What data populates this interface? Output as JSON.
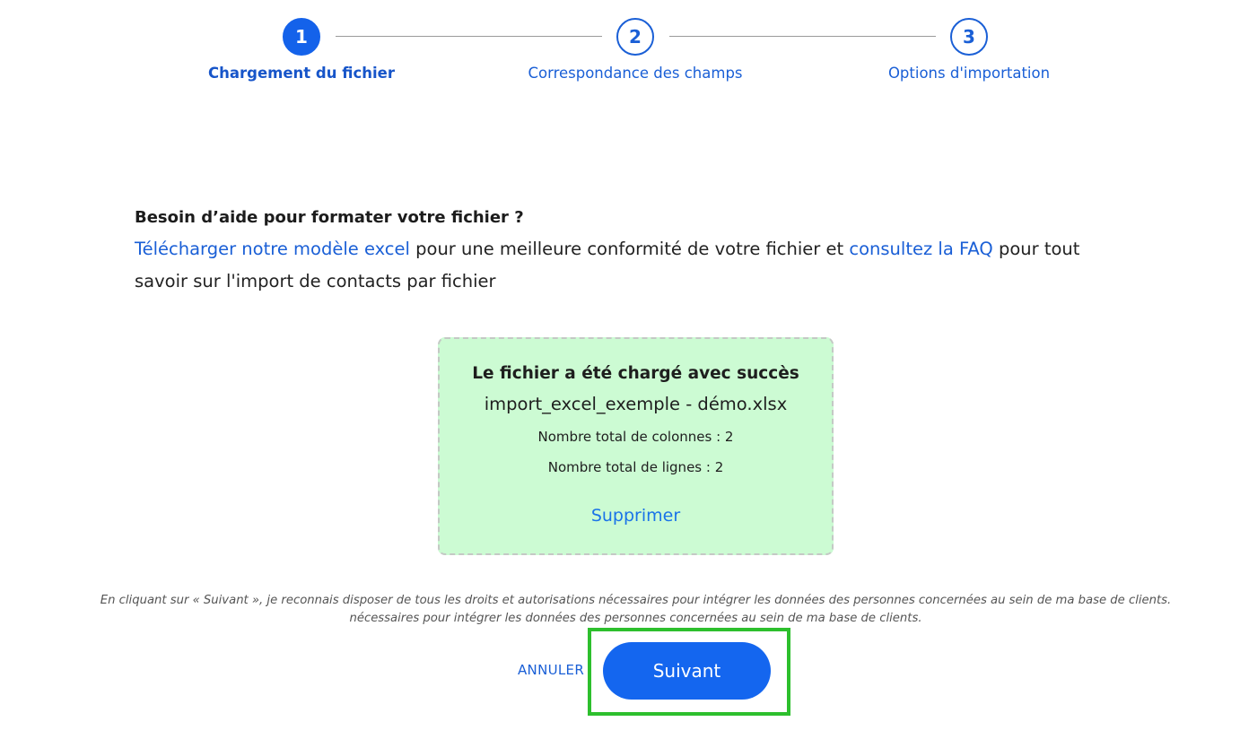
{
  "stepper": {
    "steps": [
      {
        "number": "1",
        "label": "Chargement du fichier",
        "state": "active"
      },
      {
        "number": "2",
        "label": "Correspondance des champs",
        "state": "pending"
      },
      {
        "number": "3",
        "label": "Options d'importation",
        "state": "pending"
      }
    ]
  },
  "help": {
    "title": "Besoin d’aide pour formater votre fichier ?",
    "link_template": "Télécharger notre modèle excel",
    "text_middle": " pour une meilleure conformité de votre fichier et ",
    "link_faq": "consultez la FAQ",
    "text_end": " pour tout savoir sur l'import de contacts par fichier"
  },
  "upload": {
    "status": "Le fichier a été chargé avec succès",
    "file_name": "import_excel_exemple - démo.xlsx",
    "columns_text": "Nombre total de colonnes : 2",
    "rows_text": "Nombre total de lignes : 2",
    "delete_label": "Supprimer"
  },
  "disclaimer": {
    "line1": "En cliquant sur « Suivant », je reconnais disposer de tous les droits et autorisations nécessaires pour intégrer les données des personnes concernées au sein de ma base de clients.",
    "line2": "nécessaires pour intégrer les données des personnes concernées au sein de ma base de clients."
  },
  "actions": {
    "cancel_label": "ANNULER",
    "next_label": "Suivant"
  },
  "colors": {
    "accent": "#1466ef",
    "success_bg": "#ccfbd3",
    "highlight": "#2dbf2d"
  }
}
